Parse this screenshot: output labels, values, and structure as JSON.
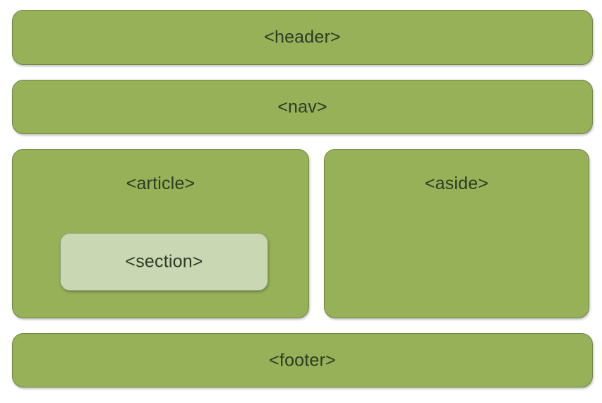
{
  "diagram": {
    "header": "<header>",
    "nav": "<nav>",
    "article": "<article>",
    "section": "<section>",
    "aside": "<aside>",
    "footer": "<footer>"
  },
  "colors": {
    "block_fill": "#96b157",
    "block_border": "#6f8744",
    "section_fill": "#c9d7b2",
    "text": "#2f3a24",
    "background": "#ffffff"
  }
}
